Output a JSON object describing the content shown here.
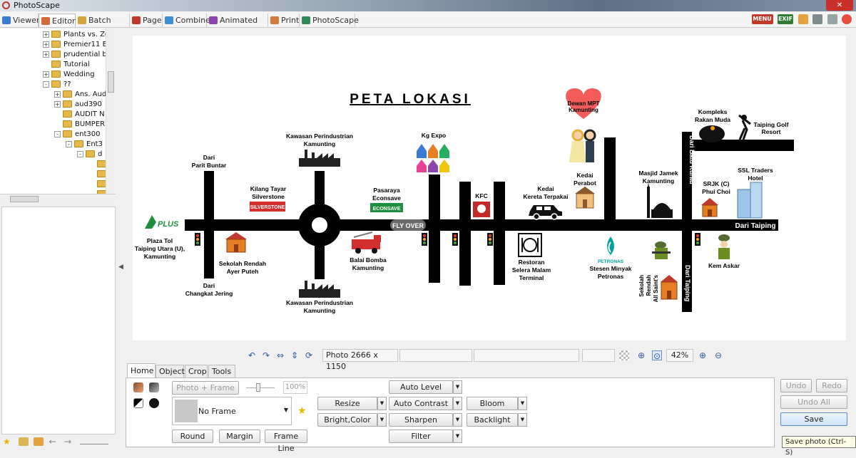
{
  "app": {
    "title": "PhotoScape"
  },
  "tabs": [
    {
      "label": "Viewer",
      "color": "#3b7bd4"
    },
    {
      "label": "Editor",
      "color": "#d46a3b"
    },
    {
      "label": "Batch Editor",
      "color": "#d4a53b"
    },
    {
      "label": "Page",
      "color": "#c0392b"
    },
    {
      "label": "Combine",
      "color": "#3b8fd4"
    },
    {
      "label": "Animated GIF",
      "color": "#8e44ad"
    },
    {
      "label": "Print",
      "color": "#d47a3b"
    },
    {
      "label": "PhotoScape",
      "color": "#2e8b57"
    }
  ],
  "top_right": {
    "menu": "MENU",
    "exif": "EXIF"
  },
  "tree": [
    {
      "label": "Plants vs. Zo",
      "expander": "+",
      "indent": 0
    },
    {
      "label": "Premier11 E",
      "expander": "+",
      "indent": 0
    },
    {
      "label": "prudential b",
      "expander": "+",
      "indent": 0
    },
    {
      "label": "Tutorial",
      "expander": "",
      "indent": 0
    },
    {
      "label": "Wedding",
      "expander": "+",
      "indent": 0
    },
    {
      "label": "??",
      "expander": "-",
      "indent": 0
    },
    {
      "label": "Ans. Aud",
      "expander": "+",
      "indent": 1
    },
    {
      "label": "aud390",
      "expander": "+",
      "indent": 1
    },
    {
      "label": "AUDIT N",
      "expander": "",
      "indent": 1
    },
    {
      "label": "BUMPER",
      "expander": "",
      "indent": 1
    },
    {
      "label": "ent300",
      "expander": "-",
      "indent": 1
    },
    {
      "label": "Ent3",
      "expander": "-",
      "indent": 2
    },
    {
      "label": "d",
      "expander": "-",
      "indent": 3
    },
    {
      "label": "",
      "expander": "",
      "indent": 4
    },
    {
      "label": "",
      "expander": "",
      "indent": 4
    },
    {
      "label": "",
      "expander": "",
      "indent": 4
    },
    {
      "label": "",
      "expander": "",
      "indent": 4
    }
  ],
  "status": {
    "photo_info": "Photo 2666 x 1150",
    "zoom": "42%"
  },
  "panel": {
    "tabs": [
      "Home",
      "Object",
      "Crop",
      "Tools"
    ],
    "photo_frame": "Photo + Frame",
    "frame_percent": "100%",
    "frame_name": "No Frame",
    "round": "Round",
    "margin": "Margin",
    "frame_line": "Frame Line",
    "resize": "Resize",
    "bright_color": "Bright,Color",
    "auto_level": "Auto Level",
    "auto_contrast": "Auto Contrast",
    "sharpen": "Sharpen",
    "filter": "Filter",
    "bloom": "Bloom",
    "backlight": "Backlight"
  },
  "actions": {
    "undo": "Undo",
    "redo": "Redo",
    "undo_all": "Undo All",
    "save": "Save",
    "tooltip": "Save photo (Ctrl-S)"
  },
  "map": {
    "title": "PETA LOKASI",
    "dewan": [
      "Dewan MPT",
      "Kamunting"
    ],
    "kompleks": [
      "Kompleks",
      "Rakan Muda"
    ],
    "golf": [
      "Taiping Golf",
      "Resort"
    ],
    "dari_parit": [
      "Dari",
      "Parit Buntar"
    ],
    "kawasan_top": [
      "Kawasan Perindustrian",
      "Kamunting"
    ],
    "kg_expo": "Kg Expo",
    "kilang": [
      "Kilang Tayar",
      "Silverstone"
    ],
    "silverstone_logo": "SILVERSTONE",
    "pasaraya": [
      "Pasaraya",
      "Econsave"
    ],
    "econsave_logo": "ECONSAVE",
    "kfc": "KFC",
    "kedai_kereta": [
      "Kedai",
      "Kereta Terpakai"
    ],
    "kedai_perabot": [
      "Kedai",
      "Perabot"
    ],
    "masjid": [
      "Masjid Jamek",
      "Kamunting"
    ],
    "dari_batu_kurau": "Dari Batu Kurau",
    "srjk": [
      "SRJK (C)",
      "Phui Choi"
    ],
    "ssl": [
      "SSL Traders",
      "Hotel"
    ],
    "dari_taiping_right": "Dari Taiping",
    "plus_logo": "PLUS",
    "plaza_tol": [
      "Plaza Tol",
      "Taiping Utara (U),",
      "Kamunting"
    ],
    "fly_over": "FLY OVER",
    "sekolah_ayer": [
      "Sekolah Rendah",
      "Ayer Puteh"
    ],
    "balai_bomba": [
      "Balai Bomba",
      "Kamunting"
    ],
    "restoran": [
      "Restoran",
      "Selera Malam",
      "Terminal"
    ],
    "petronas_logo": "PETRONAS",
    "stesen": [
      "Stesen Minyak",
      "Petronas"
    ],
    "kem_askar": "Kem Askar",
    "sekolah_saints": [
      "Sekolah",
      "Rendah",
      "All Saint's"
    ],
    "dari_taiping_bottom": "Dari Taiping",
    "dari_changkat": [
      "Dari",
      "Changkat Jering"
    ],
    "kawasan_bottom": [
      "Kawasan Perindustrian",
      "Kamunting"
    ]
  }
}
